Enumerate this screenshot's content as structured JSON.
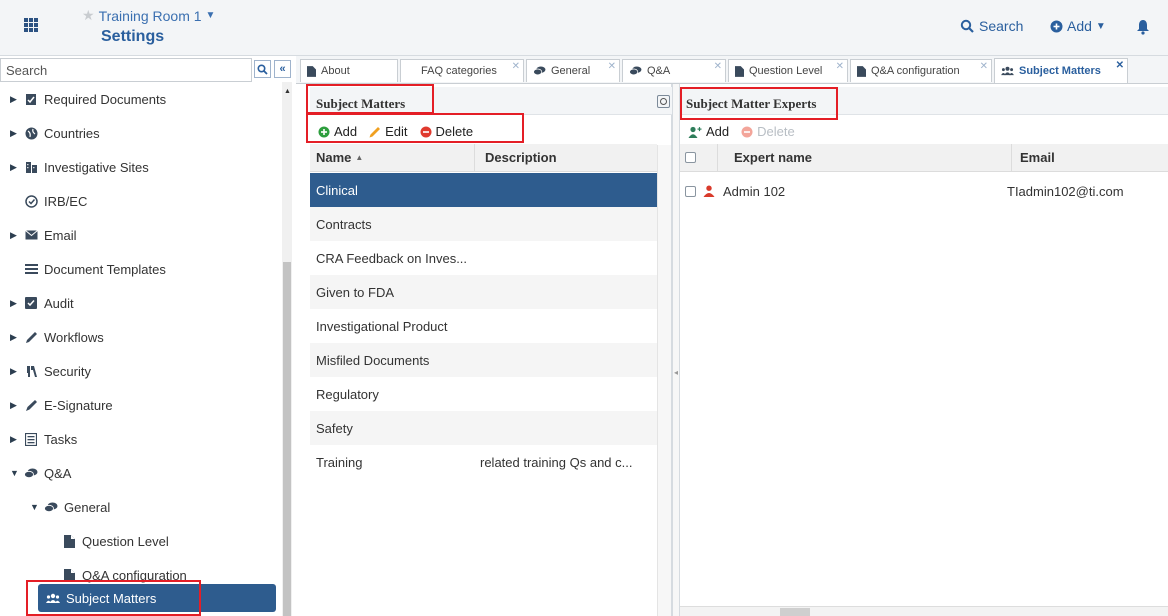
{
  "header": {
    "room_name": "Training Room 1",
    "page_title": "Settings",
    "search_label": "Search",
    "add_label": "Add"
  },
  "nav": {
    "search_placeholder": "Search",
    "items": [
      {
        "label": "Required Documents",
        "icon": "document-check-icon",
        "expandable": true
      },
      {
        "label": "Countries",
        "icon": "globe-icon",
        "expandable": true
      },
      {
        "label": "Investigative Sites",
        "icon": "building-icon",
        "expandable": true
      },
      {
        "label": "IRB/EC",
        "icon": "check-circle-icon",
        "expandable": false
      },
      {
        "label": "Email",
        "icon": "envelope-icon",
        "expandable": true
      },
      {
        "label": "Document Templates",
        "icon": "list-icon",
        "expandable": false
      },
      {
        "label": "Audit",
        "icon": "audit-check-icon",
        "expandable": true
      },
      {
        "label": "Workflows",
        "icon": "pencil-icon",
        "expandable": true
      },
      {
        "label": "Security",
        "icon": "key-icon",
        "expandable": true
      },
      {
        "label": "E-Signature",
        "icon": "pen-icon",
        "expandable": true
      },
      {
        "label": "Tasks",
        "icon": "tasks-icon",
        "expandable": true
      },
      {
        "label": "Q&A",
        "icon": "chat-icon",
        "expandable": true,
        "expanded": true
      },
      {
        "label": "General",
        "icon": "chat-icon",
        "expandable": true,
        "expanded": true
      },
      {
        "label": "Question Level",
        "icon": "file-icon",
        "expandable": false
      },
      {
        "label": "Q&A configuration",
        "icon": "file-icon",
        "expandable": false
      },
      {
        "label": "Subject Matters",
        "icon": "users-icon",
        "expandable": false,
        "selected": true
      }
    ]
  },
  "tabs": [
    {
      "label": "About",
      "icon": "file-icon",
      "closable": false
    },
    {
      "label": "FAQ categories",
      "icon": "",
      "closable": true
    },
    {
      "label": "General",
      "icon": "chat-icon",
      "closable": true
    },
    {
      "label": "Q&A",
      "icon": "chat-icon",
      "closable": true
    },
    {
      "label": "Question Level",
      "icon": "file-icon",
      "closable": true
    },
    {
      "label": "Q&A configuration",
      "icon": "file-icon",
      "closable": true
    },
    {
      "label": "Subject Matters",
      "icon": "users-icon",
      "closable": true,
      "active": true
    }
  ],
  "subject_matters": {
    "title": "Subject Matters",
    "toolbar": {
      "add": "Add",
      "edit": "Edit",
      "delete": "Delete"
    },
    "columns": {
      "name": "Name",
      "description": "Description"
    },
    "rows": [
      {
        "name": "Clinical",
        "description": "",
        "selected": true
      },
      {
        "name": "Contracts",
        "description": ""
      },
      {
        "name": "CRA Feedback on Inves...",
        "description": ""
      },
      {
        "name": "Given to FDA",
        "description": ""
      },
      {
        "name": "Investigational Product",
        "description": ""
      },
      {
        "name": "Misfiled Documents",
        "description": ""
      },
      {
        "name": "Regulatory",
        "description": ""
      },
      {
        "name": "Safety",
        "description": ""
      },
      {
        "name": "Training",
        "description": "related training Qs and c..."
      }
    ]
  },
  "experts": {
    "title": "Subject Matter Experts",
    "toolbar": {
      "add": "Add",
      "delete": "Delete"
    },
    "columns": {
      "name": "Expert name",
      "email": "Email"
    },
    "rows": [
      {
        "name": "Admin 102",
        "email": "TIadmin102@ti.com"
      }
    ]
  },
  "colors": {
    "accent": "#2a5f9e",
    "selected_bg": "#2e5c8e",
    "annotation_red": "#e41e26",
    "add_green": "#2e9e3e",
    "edit_orange": "#f0a020",
    "delete_red": "#e03a2e"
  }
}
